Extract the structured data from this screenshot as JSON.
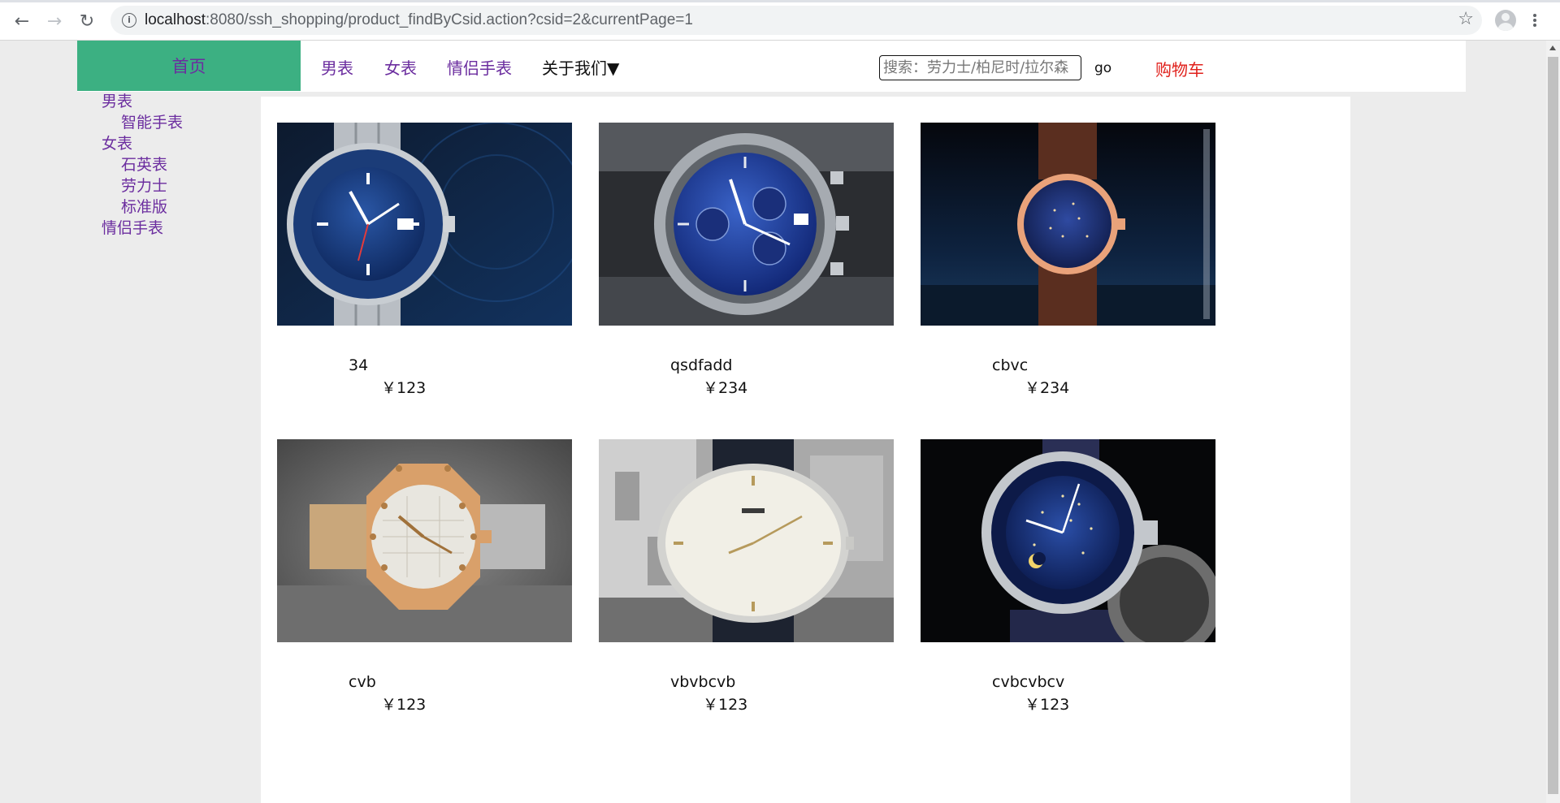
{
  "browser": {
    "url_host": "localhost",
    "url_rest": ":8080/ssh_shopping/product_findByCsid.action?csid=2&currentPage=1"
  },
  "header": {
    "home_label": "首页",
    "nav": [
      "男表",
      "女表",
      "情侣手表"
    ],
    "about_label": "关于我们▼",
    "search_placeholder": "搜索：劳力士/柏尼时/拉尔森",
    "go_label": "go",
    "cart_label": "购物车"
  },
  "sidebar": {
    "items": [
      {
        "label": "男表",
        "sub": false
      },
      {
        "label": "智能手表",
        "sub": true
      },
      {
        "label": "女表",
        "sub": false
      },
      {
        "label": "石英表",
        "sub": true
      },
      {
        "label": "劳力士",
        "sub": true
      },
      {
        "label": "标准版",
        "sub": true
      },
      {
        "label": "情侣手表",
        "sub": false
      }
    ]
  },
  "products": [
    {
      "name": "34",
      "price": "￥123",
      "image": "blue-diver-watch"
    },
    {
      "name": "qsdfadd",
      "price": "￥234",
      "image": "blue-chronograph-watch"
    },
    {
      "name": "cbvc",
      "price": "￥234",
      "image": "rose-gold-night-sky-watch"
    },
    {
      "name": "cvb",
      "price": "￥123",
      "image": "octagonal-bezel-watch"
    },
    {
      "name": "vbvbcvb",
      "price": "￥123",
      "image": "white-dial-dress-watch"
    },
    {
      "name": "cvbcvbcv",
      "price": "￥123",
      "image": "celestial-moon-phase-watch"
    }
  ],
  "colors": {
    "home_tab_bg": "#3cb082",
    "link_purple": "#6b2d9f",
    "cart_red": "#e0201b"
  }
}
